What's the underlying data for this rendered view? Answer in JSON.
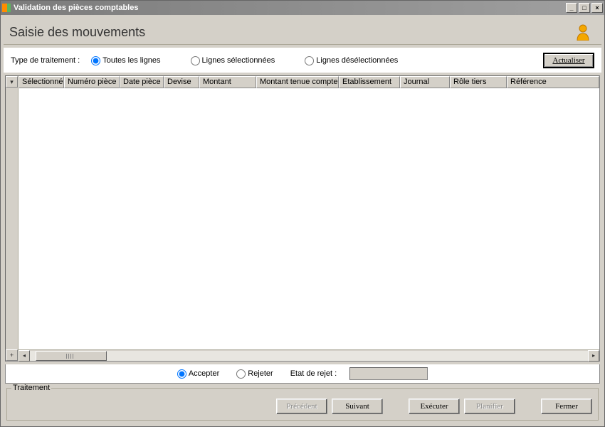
{
  "window": {
    "title": "Validation des pièces comptables"
  },
  "page": {
    "title": "Saisie des mouvements"
  },
  "filter": {
    "label": "Type de traitement :",
    "options": {
      "all": "Toutes les lignes",
      "selected": "Lignes sélectionnées",
      "deselected": "Lignes désélectionnées"
    },
    "refresh": "Actualiser"
  },
  "columns": {
    "selectionne": "Sélectionné",
    "numero_piece": "Numéro pièce",
    "date_piece": "Date pièce",
    "devise": "Devise",
    "montant": "Montant",
    "montant_tenue": "Montant tenue compte",
    "etablissement": "Etablissement",
    "journal": "Journal",
    "role_tiers": "Rôle tiers",
    "reference": "Référence"
  },
  "actions": {
    "accept": "Accepter",
    "reject": "Rejeter",
    "etat_label": "Etat de rejet :"
  },
  "footer": {
    "legend": "Traitement",
    "prev": "Précédent",
    "next": "Suivant",
    "execute": "Exécuter",
    "schedule": "Planifier",
    "close": "Fermer"
  }
}
